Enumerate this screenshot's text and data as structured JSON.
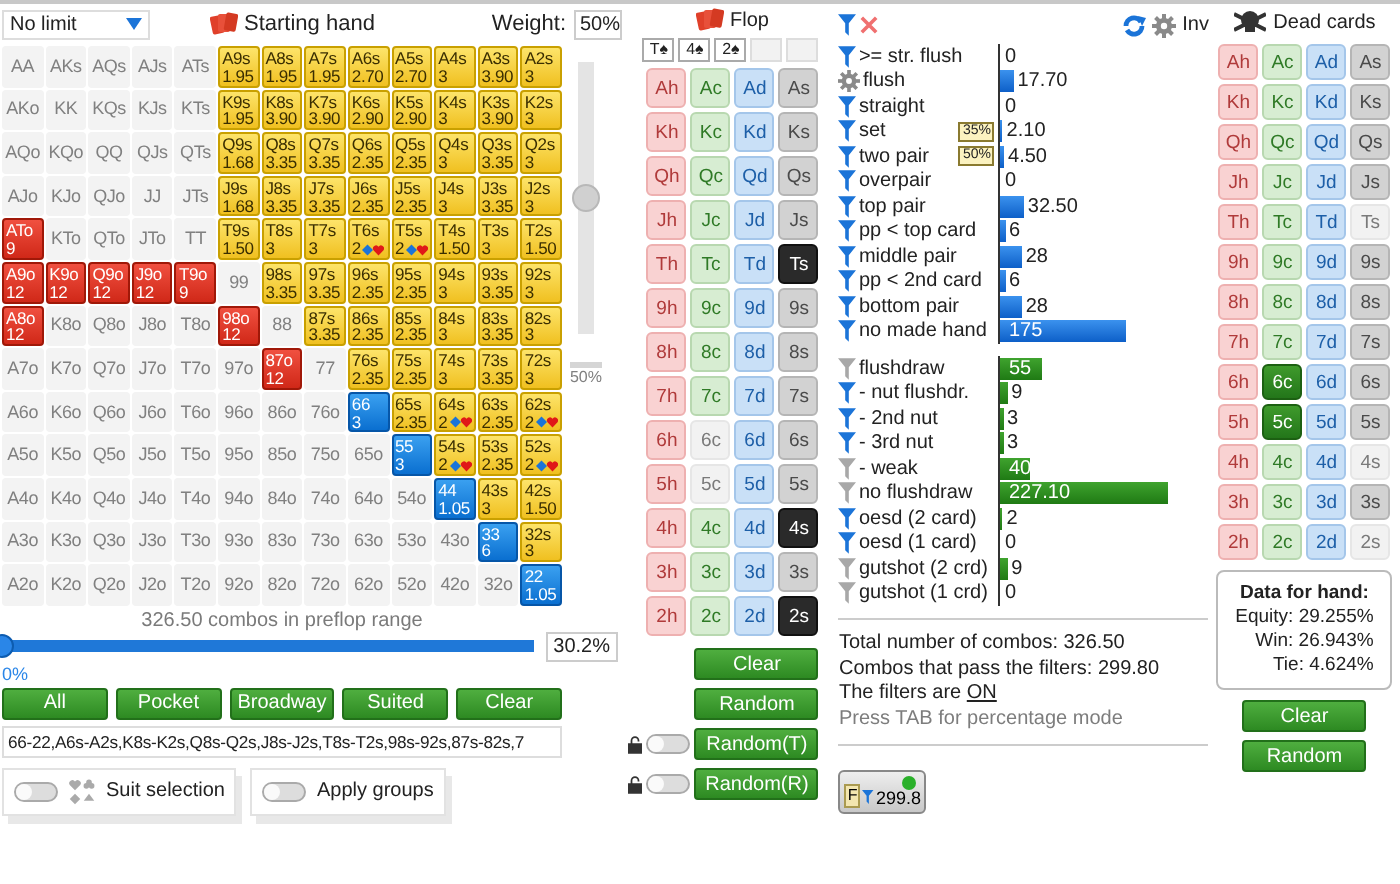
{
  "game": {
    "mode": "No limit"
  },
  "starting_hand": {
    "title": "Starting hand",
    "weight_label": "Weight:",
    "weight": "50%",
    "weight_slider": {
      "level": 0.5
    },
    "weight_slider_label": "50%"
  },
  "range": {
    "grid": [
      [
        {
          "hand": "AA",
          "kind": "off"
        },
        {
          "hand": "AKs",
          "kind": "off"
        },
        {
          "hand": "AQs",
          "kind": "off"
        },
        {
          "hand": "AJs",
          "kind": "off"
        },
        {
          "hand": "ATs",
          "kind": "off"
        },
        {
          "hand": "A9s",
          "kind": "suited",
          "combos": "1.95",
          "partial": false
        },
        {
          "hand": "A8s",
          "kind": "suited",
          "combos": "1.95",
          "partial": false
        },
        {
          "hand": "A7s",
          "kind": "suited",
          "combos": "1.95",
          "partial": false
        },
        {
          "hand": "A6s",
          "kind": "suited",
          "combos": "2.70",
          "partial": false
        },
        {
          "hand": "A5s",
          "kind": "suited",
          "combos": "2.70",
          "partial": false
        },
        {
          "hand": "A4s",
          "kind": "suited",
          "combos": "3",
          "partial": false
        },
        {
          "hand": "A3s",
          "kind": "suited",
          "combos": "3.90",
          "partial": false
        },
        {
          "hand": "A2s",
          "kind": "suited",
          "combos": "3",
          "partial": false
        }
      ],
      [
        {
          "hand": "AKo",
          "kind": "off"
        },
        {
          "hand": "KK",
          "kind": "off"
        },
        {
          "hand": "KQs",
          "kind": "off"
        },
        {
          "hand": "KJs",
          "kind": "off"
        },
        {
          "hand": "KTs",
          "kind": "off"
        },
        {
          "hand": "K9s",
          "kind": "suited",
          "combos": "1.95",
          "partial": false
        },
        {
          "hand": "K8s",
          "kind": "suited",
          "combos": "3.90",
          "partial": false
        },
        {
          "hand": "K7s",
          "kind": "suited",
          "combos": "3.90",
          "partial": false
        },
        {
          "hand": "K6s",
          "kind": "suited",
          "combos": "2.90",
          "partial": false
        },
        {
          "hand": "K5s",
          "kind": "suited",
          "combos": "2.90",
          "partial": false
        },
        {
          "hand": "K4s",
          "kind": "suited",
          "combos": "3",
          "partial": false
        },
        {
          "hand": "K3s",
          "kind": "suited",
          "combos": "3.90",
          "partial": false
        },
        {
          "hand": "K2s",
          "kind": "suited",
          "combos": "3",
          "partial": false
        }
      ],
      [
        {
          "hand": "AQo",
          "kind": "off"
        },
        {
          "hand": "KQo",
          "kind": "off"
        },
        {
          "hand": "QQ",
          "kind": "off"
        },
        {
          "hand": "QJs",
          "kind": "off"
        },
        {
          "hand": "QTs",
          "kind": "off"
        },
        {
          "hand": "Q9s",
          "kind": "suited",
          "combos": "1.68",
          "partial": false
        },
        {
          "hand": "Q8s",
          "kind": "suited",
          "combos": "3.35",
          "partial": false
        },
        {
          "hand": "Q7s",
          "kind": "suited",
          "combos": "3.35",
          "partial": false
        },
        {
          "hand": "Q6s",
          "kind": "suited",
          "combos": "2.35",
          "partial": false
        },
        {
          "hand": "Q5s",
          "kind": "suited",
          "combos": "2.35",
          "partial": false
        },
        {
          "hand": "Q4s",
          "kind": "suited",
          "combos": "3",
          "partial": false
        },
        {
          "hand": "Q3s",
          "kind": "suited",
          "combos": "3.35",
          "partial": false
        },
        {
          "hand": "Q2s",
          "kind": "suited",
          "combos": "3",
          "partial": false
        }
      ],
      [
        {
          "hand": "AJo",
          "kind": "off"
        },
        {
          "hand": "KJo",
          "kind": "off"
        },
        {
          "hand": "QJo",
          "kind": "off"
        },
        {
          "hand": "JJ",
          "kind": "off"
        },
        {
          "hand": "JTs",
          "kind": "off"
        },
        {
          "hand": "J9s",
          "kind": "suited",
          "combos": "1.68",
          "partial": false
        },
        {
          "hand": "J8s",
          "kind": "suited",
          "combos": "3.35",
          "partial": false
        },
        {
          "hand": "J7s",
          "kind": "suited",
          "combos": "3.35",
          "partial": false
        },
        {
          "hand": "J6s",
          "kind": "suited",
          "combos": "2.35",
          "partial": false
        },
        {
          "hand": "J5s",
          "kind": "suited",
          "combos": "2.35",
          "partial": false
        },
        {
          "hand": "J4s",
          "kind": "suited",
          "combos": "3",
          "partial": false
        },
        {
          "hand": "J3s",
          "kind": "suited",
          "combos": "3.35",
          "partial": false
        },
        {
          "hand": "J2s",
          "kind": "suited",
          "combos": "3",
          "partial": false
        }
      ],
      [
        {
          "hand": "ATo",
          "kind": "offsuit",
          "combos": "9",
          "partial": false
        },
        {
          "hand": "KTo",
          "kind": "off"
        },
        {
          "hand": "QTo",
          "kind": "off"
        },
        {
          "hand": "JTo",
          "kind": "off"
        },
        {
          "hand": "TT",
          "kind": "off"
        },
        {
          "hand": "T9s",
          "kind": "suited",
          "combos": "1.50",
          "partial": false
        },
        {
          "hand": "T8s",
          "kind": "suited",
          "combos": "3",
          "partial": false
        },
        {
          "hand": "T7s",
          "kind": "suited",
          "combos": "3",
          "partial": false
        },
        {
          "hand": "T6s",
          "kind": "suited",
          "combos": "2",
          "partial": true
        },
        {
          "hand": "T5s",
          "kind": "suited",
          "combos": "2",
          "partial": true
        },
        {
          "hand": "T4s",
          "kind": "suited",
          "combos": "1.50",
          "partial": false
        },
        {
          "hand": "T3s",
          "kind": "suited",
          "combos": "3",
          "partial": false
        },
        {
          "hand": "T2s",
          "kind": "suited",
          "combos": "1.50",
          "partial": false
        }
      ],
      [
        {
          "hand": "A9o",
          "kind": "offsuit",
          "combos": "12",
          "partial": false
        },
        {
          "hand": "K9o",
          "kind": "offsuit",
          "combos": "12",
          "partial": false
        },
        {
          "hand": "Q9o",
          "kind": "offsuit",
          "combos": "12",
          "partial": false
        },
        {
          "hand": "J9o",
          "kind": "offsuit",
          "combos": "12",
          "partial": false
        },
        {
          "hand": "T9o",
          "kind": "offsuit",
          "combos": "9",
          "partial": false
        },
        {
          "hand": "99",
          "kind": "off"
        },
        {
          "hand": "98s",
          "kind": "suited",
          "combos": "3.35",
          "partial": false
        },
        {
          "hand": "97s",
          "kind": "suited",
          "combos": "3.35",
          "partial": false
        },
        {
          "hand": "96s",
          "kind": "suited",
          "combos": "2.35",
          "partial": false
        },
        {
          "hand": "95s",
          "kind": "suited",
          "combos": "2.35",
          "partial": false
        },
        {
          "hand": "94s",
          "kind": "suited",
          "combos": "3",
          "partial": false
        },
        {
          "hand": "93s",
          "kind": "suited",
          "combos": "3.35",
          "partial": false
        },
        {
          "hand": "92s",
          "kind": "suited",
          "combos": "3",
          "partial": false
        }
      ],
      [
        {
          "hand": "A8o",
          "kind": "offsuit",
          "combos": "12",
          "partial": false
        },
        {
          "hand": "K8o",
          "kind": "off"
        },
        {
          "hand": "Q8o",
          "kind": "off"
        },
        {
          "hand": "J8o",
          "kind": "off"
        },
        {
          "hand": "T8o",
          "kind": "off"
        },
        {
          "hand": "98o",
          "kind": "offsuit",
          "combos": "12",
          "partial": false
        },
        {
          "hand": "88",
          "kind": "off"
        },
        {
          "hand": "87s",
          "kind": "suited",
          "combos": "3.35",
          "partial": false
        },
        {
          "hand": "86s",
          "kind": "suited",
          "combos": "2.35",
          "partial": false
        },
        {
          "hand": "85s",
          "kind": "suited",
          "combos": "2.35",
          "partial": false
        },
        {
          "hand": "84s",
          "kind": "suited",
          "combos": "3",
          "partial": false
        },
        {
          "hand": "83s",
          "kind": "suited",
          "combos": "3.35",
          "partial": false
        },
        {
          "hand": "82s",
          "kind": "suited",
          "combos": "3",
          "partial": false
        }
      ],
      [
        {
          "hand": "A7o",
          "kind": "off"
        },
        {
          "hand": "K7o",
          "kind": "off"
        },
        {
          "hand": "Q7o",
          "kind": "off"
        },
        {
          "hand": "J7o",
          "kind": "off"
        },
        {
          "hand": "T7o",
          "kind": "off"
        },
        {
          "hand": "97o",
          "kind": "off"
        },
        {
          "hand": "87o",
          "kind": "offsuit",
          "combos": "12",
          "partial": false
        },
        {
          "hand": "77",
          "kind": "off"
        },
        {
          "hand": "76s",
          "kind": "suited",
          "combos": "2.35",
          "partial": false
        },
        {
          "hand": "75s",
          "kind": "suited",
          "combos": "2.35",
          "partial": false
        },
        {
          "hand": "74s",
          "kind": "suited",
          "combos": "3",
          "partial": false
        },
        {
          "hand": "73s",
          "kind": "suited",
          "combos": "3.35",
          "partial": false
        },
        {
          "hand": "72s",
          "kind": "suited",
          "combos": "3",
          "partial": false
        }
      ],
      [
        {
          "hand": "A6o",
          "kind": "off"
        },
        {
          "hand": "K6o",
          "kind": "off"
        },
        {
          "hand": "Q6o",
          "kind": "off"
        },
        {
          "hand": "J6o",
          "kind": "off"
        },
        {
          "hand": "T6o",
          "kind": "off"
        },
        {
          "hand": "96o",
          "kind": "off"
        },
        {
          "hand": "86o",
          "kind": "off"
        },
        {
          "hand": "76o",
          "kind": "off"
        },
        {
          "hand": "66",
          "kind": "pair",
          "combos": "3",
          "partial": false
        },
        {
          "hand": "65s",
          "kind": "suited",
          "combos": "2.35",
          "partial": false
        },
        {
          "hand": "64s",
          "kind": "suited",
          "combos": "2",
          "partial": true
        },
        {
          "hand": "63s",
          "kind": "suited",
          "combos": "2.35",
          "partial": false
        },
        {
          "hand": "62s",
          "kind": "suited",
          "combos": "2",
          "partial": true
        }
      ],
      [
        {
          "hand": "A5o",
          "kind": "off"
        },
        {
          "hand": "K5o",
          "kind": "off"
        },
        {
          "hand": "Q5o",
          "kind": "off"
        },
        {
          "hand": "J5o",
          "kind": "off"
        },
        {
          "hand": "T5o",
          "kind": "off"
        },
        {
          "hand": "95o",
          "kind": "off"
        },
        {
          "hand": "85o",
          "kind": "off"
        },
        {
          "hand": "75o",
          "kind": "off"
        },
        {
          "hand": "65o",
          "kind": "off"
        },
        {
          "hand": "55",
          "kind": "pair",
          "combos": "3",
          "partial": false
        },
        {
          "hand": "54s",
          "kind": "suited",
          "combos": "2",
          "partial": true
        },
        {
          "hand": "53s",
          "kind": "suited",
          "combos": "2.35",
          "partial": false
        },
        {
          "hand": "52s",
          "kind": "suited",
          "combos": "2",
          "partial": true
        }
      ],
      [
        {
          "hand": "A4o",
          "kind": "off"
        },
        {
          "hand": "K4o",
          "kind": "off"
        },
        {
          "hand": "Q4o",
          "kind": "off"
        },
        {
          "hand": "J4o",
          "kind": "off"
        },
        {
          "hand": "T4o",
          "kind": "off"
        },
        {
          "hand": "94o",
          "kind": "off"
        },
        {
          "hand": "84o",
          "kind": "off"
        },
        {
          "hand": "74o",
          "kind": "off"
        },
        {
          "hand": "64o",
          "kind": "off"
        },
        {
          "hand": "54o",
          "kind": "off"
        },
        {
          "hand": "44",
          "kind": "pair",
          "combos": "1.05",
          "partial": false
        },
        {
          "hand": "43s",
          "kind": "suited",
          "combos": "3",
          "partial": false
        },
        {
          "hand": "42s",
          "kind": "suited",
          "combos": "1.50",
          "partial": false
        }
      ],
      [
        {
          "hand": "A3o",
          "kind": "off"
        },
        {
          "hand": "K3o",
          "kind": "off"
        },
        {
          "hand": "Q3o",
          "kind": "off"
        },
        {
          "hand": "J3o",
          "kind": "off"
        },
        {
          "hand": "T3o",
          "kind": "off"
        },
        {
          "hand": "93o",
          "kind": "off"
        },
        {
          "hand": "83o",
          "kind": "off"
        },
        {
          "hand": "73o",
          "kind": "off"
        },
        {
          "hand": "63o",
          "kind": "off"
        },
        {
          "hand": "53o",
          "kind": "off"
        },
        {
          "hand": "43o",
          "kind": "off"
        },
        {
          "hand": "33",
          "kind": "pair",
          "combos": "6",
          "partial": false
        },
        {
          "hand": "32s",
          "kind": "suited",
          "combos": "3",
          "partial": false
        }
      ],
      [
        {
          "hand": "A2o",
          "kind": "off"
        },
        {
          "hand": "K2o",
          "kind": "off"
        },
        {
          "hand": "Q2o",
          "kind": "off"
        },
        {
          "hand": "J2o",
          "kind": "off"
        },
        {
          "hand": "T2o",
          "kind": "off"
        },
        {
          "hand": "92o",
          "kind": "off"
        },
        {
          "hand": "82o",
          "kind": "off"
        },
        {
          "hand": "72o",
          "kind": "off"
        },
        {
          "hand": "62o",
          "kind": "off"
        },
        {
          "hand": "52o",
          "kind": "off"
        },
        {
          "hand": "42o",
          "kind": "off"
        },
        {
          "hand": "32o",
          "kind": "off"
        },
        {
          "hand": "22",
          "kind": "pair",
          "combos": "1.05",
          "partial": false
        }
      ]
    ],
    "combos_text": "326.50 combos in preflop range",
    "slider": {
      "level": 0,
      "min_label": "0%",
      "value": "30.2%"
    },
    "buttons": [
      "All",
      "Pocket",
      "Broadway",
      "Suited",
      "Clear"
    ],
    "text": "66-22,A6s-A2s,K8s-K2s,Q8s-Q2s,J8s-J2s,T8s-T2s,98s-92s,87s-82s,7",
    "toggles": [
      {
        "label": "Suit selection",
        "kind": "suits",
        "on": false
      },
      {
        "label": "Apply groups",
        "kind": "plain",
        "on": false
      }
    ]
  },
  "flop": {
    "title": "Flop",
    "board": [
      "T♠",
      "4♠",
      "2♠"
    ],
    "cards": [
      [
        {
          "label": "Ah",
          "selected": false,
          "disabled": false
        },
        {
          "label": "Ac",
          "selected": false,
          "disabled": false
        },
        {
          "label": "Ad",
          "selected": false,
          "disabled": false
        },
        {
          "label": "As",
          "selected": false,
          "disabled": false
        }
      ],
      [
        {
          "label": "Kh",
          "selected": false,
          "disabled": false
        },
        {
          "label": "Kc",
          "selected": false,
          "disabled": false
        },
        {
          "label": "Kd",
          "selected": false,
          "disabled": false
        },
        {
          "label": "Ks",
          "selected": false,
          "disabled": false
        }
      ],
      [
        {
          "label": "Qh",
          "selected": false,
          "disabled": false
        },
        {
          "label": "Qc",
          "selected": false,
          "disabled": false
        },
        {
          "label": "Qd",
          "selected": false,
          "disabled": false
        },
        {
          "label": "Qs",
          "selected": false,
          "disabled": false
        }
      ],
      [
        {
          "label": "Jh",
          "selected": false,
          "disabled": false
        },
        {
          "label": "Jc",
          "selected": false,
          "disabled": false
        },
        {
          "label": "Jd",
          "selected": false,
          "disabled": false
        },
        {
          "label": "Js",
          "selected": false,
          "disabled": false
        }
      ],
      [
        {
          "label": "Th",
          "selected": false,
          "disabled": false
        },
        {
          "label": "Tc",
          "selected": false,
          "disabled": false
        },
        {
          "label": "Td",
          "selected": false,
          "disabled": false
        },
        {
          "label": "Ts",
          "selected": true,
          "disabled": false
        }
      ],
      [
        {
          "label": "9h",
          "selected": false,
          "disabled": false
        },
        {
          "label": "9c",
          "selected": false,
          "disabled": false
        },
        {
          "label": "9d",
          "selected": false,
          "disabled": false
        },
        {
          "label": "9s",
          "selected": false,
          "disabled": false
        }
      ],
      [
        {
          "label": "8h",
          "selected": false,
          "disabled": false
        },
        {
          "label": "8c",
          "selected": false,
          "disabled": false
        },
        {
          "label": "8d",
          "selected": false,
          "disabled": false
        },
        {
          "label": "8s",
          "selected": false,
          "disabled": false
        }
      ],
      [
        {
          "label": "7h",
          "selected": false,
          "disabled": false
        },
        {
          "label": "7c",
          "selected": false,
          "disabled": false
        },
        {
          "label": "7d",
          "selected": false,
          "disabled": false
        },
        {
          "label": "7s",
          "selected": false,
          "disabled": false
        }
      ],
      [
        {
          "label": "6h",
          "selected": false,
          "disabled": false
        },
        {
          "label": "6c",
          "selected": false,
          "disabled": true
        },
        {
          "label": "6d",
          "selected": false,
          "disabled": false
        },
        {
          "label": "6s",
          "selected": false,
          "disabled": false
        }
      ],
      [
        {
          "label": "5h",
          "selected": false,
          "disabled": false
        },
        {
          "label": "5c",
          "selected": false,
          "disabled": true
        },
        {
          "label": "5d",
          "selected": false,
          "disabled": false
        },
        {
          "label": "5s",
          "selected": false,
          "disabled": false
        }
      ],
      [
        {
          "label": "4h",
          "selected": false,
          "disabled": false
        },
        {
          "label": "4c",
          "selected": false,
          "disabled": false
        },
        {
          "label": "4d",
          "selected": false,
          "disabled": false
        },
        {
          "label": "4s",
          "selected": true,
          "disabled": false
        }
      ],
      [
        {
          "label": "3h",
          "selected": false,
          "disabled": false
        },
        {
          "label": "3c",
          "selected": false,
          "disabled": false
        },
        {
          "label": "3d",
          "selected": false,
          "disabled": false
        },
        {
          "label": "3s",
          "selected": false,
          "disabled": false
        }
      ],
      [
        {
          "label": "2h",
          "selected": false,
          "disabled": false
        },
        {
          "label": "2c",
          "selected": false,
          "disabled": false
        },
        {
          "label": "2d",
          "selected": false,
          "disabled": false
        },
        {
          "label": "2s",
          "selected": true,
          "disabled": false
        }
      ]
    ],
    "buttons": [
      {
        "label": "Clear",
        "kind": "plain"
      },
      {
        "label": "Random",
        "kind": "plain"
      },
      {
        "label": "Random(T)",
        "kind": "locked",
        "on": false
      },
      {
        "label": "Random(R)",
        "kind": "locked",
        "on": false
      }
    ]
  },
  "filters": {
    "inv": "Inv",
    "made": [
      {
        "label": ">= str. flush",
        "kind": "filter",
        "on": true,
        "value": "0",
        "level": 0
      },
      {
        "label": "flush",
        "kind": "gear",
        "value": "17.70",
        "level": 0.06
      },
      {
        "label": "straight",
        "kind": "filter",
        "on": true,
        "value": "0",
        "level": 0
      },
      {
        "label": "set",
        "kind": "filter",
        "on": true,
        "badge": "35%",
        "value": "2.10",
        "level": 0.008
      },
      {
        "label": "two pair",
        "kind": "filter",
        "on": true,
        "badge": "50%",
        "value": "4.50",
        "level": 0.015
      },
      {
        "label": "overpair",
        "kind": "filter",
        "on": true,
        "value": "0",
        "level": 0
      },
      {
        "label": "top pair",
        "kind": "filter",
        "on": true,
        "value": "32.50",
        "level": 0.11
      },
      {
        "label": "pp < top card",
        "kind": "filter",
        "on": true,
        "value": "6",
        "level": 0.02
      },
      {
        "label": "middle pair",
        "kind": "filter",
        "on": true,
        "value": "28",
        "level": 0.1
      },
      {
        "label": "pp < 2nd card",
        "kind": "filter",
        "on": true,
        "value": "6",
        "level": 0.02
      },
      {
        "label": "bottom pair",
        "kind": "filter",
        "on": true,
        "value": "28",
        "level": 0.1
      },
      {
        "label": "no made hand",
        "kind": "filter",
        "on": true,
        "value": "175",
        "level": 0.6
      }
    ],
    "draws": [
      {
        "label": "flushdraw",
        "kind": "filter",
        "on": false,
        "value": "55",
        "level": 0.2
      },
      {
        "label": "- nut flushdr.",
        "kind": "filter",
        "on": true,
        "value": "9",
        "level": 0.03
      },
      {
        "label": "- 2nd nut",
        "kind": "filter",
        "on": true,
        "value": "3",
        "level": 0.01
      },
      {
        "label": "- 3rd nut",
        "kind": "filter",
        "on": true,
        "value": "3",
        "level": 0.01
      },
      {
        "label": "- weak",
        "kind": "filter",
        "on": false,
        "value": "40",
        "level": 0.14
      },
      {
        "label": "no flushdraw",
        "kind": "filter",
        "on": false,
        "value": "227.10",
        "level": 0.8
      },
      {
        "label": "oesd (2 card)",
        "kind": "filter",
        "on": true,
        "value": "2",
        "level": 0.007
      },
      {
        "label": "oesd (1 card)",
        "kind": "filter",
        "on": true,
        "value": "0",
        "level": 0
      },
      {
        "label": "gutshot (2 crd)",
        "kind": "filter",
        "on": false,
        "value": "9",
        "level": 0.03
      },
      {
        "label": "gutshot (1 crd)",
        "kind": "filter",
        "on": false,
        "value": "0",
        "level": 0
      }
    ],
    "summary": {
      "total": "Total number of combos: 326.50",
      "pass": "Combos that pass the filters: 299.80",
      "status": "The filters are",
      "status_link": "ON",
      "hint": "Press TAB for percentage mode"
    },
    "count_button": {
      "letter": "F",
      "value": "299.8",
      "active": true
    }
  },
  "dead": {
    "title": "Dead cards",
    "cards": [
      [
        {
          "label": "Ah",
          "selected": false,
          "disabled": false
        },
        {
          "label": "Ac",
          "selected": false,
          "disabled": false
        },
        {
          "label": "Ad",
          "selected": false,
          "disabled": false
        },
        {
          "label": "As",
          "selected": false,
          "disabled": false
        }
      ],
      [
        {
          "label": "Kh",
          "selected": false,
          "disabled": false
        },
        {
          "label": "Kc",
          "selected": false,
          "disabled": false
        },
        {
          "label": "Kd",
          "selected": false,
          "disabled": false
        },
        {
          "label": "Ks",
          "selected": false,
          "disabled": false
        }
      ],
      [
        {
          "label": "Qh",
          "selected": false,
          "disabled": false
        },
        {
          "label": "Qc",
          "selected": false,
          "disabled": false
        },
        {
          "label": "Qd",
          "selected": false,
          "disabled": false
        },
        {
          "label": "Qs",
          "selected": false,
          "disabled": false
        }
      ],
      [
        {
          "label": "Jh",
          "selected": false,
          "disabled": false
        },
        {
          "label": "Jc",
          "selected": false,
          "disabled": false
        },
        {
          "label": "Jd",
          "selected": false,
          "disabled": false
        },
        {
          "label": "Js",
          "selected": false,
          "disabled": false
        }
      ],
      [
        {
          "label": "Th",
          "selected": false,
          "disabled": false
        },
        {
          "label": "Tc",
          "selected": false,
          "disabled": false
        },
        {
          "label": "Td",
          "selected": false,
          "disabled": false
        },
        {
          "label": "Ts",
          "selected": false,
          "disabled": true
        }
      ],
      [
        {
          "label": "9h",
          "selected": false,
          "disabled": false
        },
        {
          "label": "9c",
          "selected": false,
          "disabled": false
        },
        {
          "label": "9d",
          "selected": false,
          "disabled": false
        },
        {
          "label": "9s",
          "selected": false,
          "disabled": false
        }
      ],
      [
        {
          "label": "8h",
          "selected": false,
          "disabled": false
        },
        {
          "label": "8c",
          "selected": false,
          "disabled": false
        },
        {
          "label": "8d",
          "selected": false,
          "disabled": false
        },
        {
          "label": "8s",
          "selected": false,
          "disabled": false
        }
      ],
      [
        {
          "label": "7h",
          "selected": false,
          "disabled": false
        },
        {
          "label": "7c",
          "selected": false,
          "disabled": false
        },
        {
          "label": "7d",
          "selected": false,
          "disabled": false
        },
        {
          "label": "7s",
          "selected": false,
          "disabled": false
        }
      ],
      [
        {
          "label": "6h",
          "selected": false,
          "disabled": false
        },
        {
          "label": "6c",
          "selected": true,
          "disabled": false
        },
        {
          "label": "6d",
          "selected": false,
          "disabled": false
        },
        {
          "label": "6s",
          "selected": false,
          "disabled": false
        }
      ],
      [
        {
          "label": "5h",
          "selected": false,
          "disabled": false
        },
        {
          "label": "5c",
          "selected": true,
          "disabled": false
        },
        {
          "label": "5d",
          "selected": false,
          "disabled": false
        },
        {
          "label": "5s",
          "selected": false,
          "disabled": false
        }
      ],
      [
        {
          "label": "4h",
          "selected": false,
          "disabled": false
        },
        {
          "label": "4c",
          "selected": false,
          "disabled": false
        },
        {
          "label": "4d",
          "selected": false,
          "disabled": false
        },
        {
          "label": "4s",
          "selected": false,
          "disabled": true
        }
      ],
      [
        {
          "label": "3h",
          "selected": false,
          "disabled": false
        },
        {
          "label": "3c",
          "selected": false,
          "disabled": false
        },
        {
          "label": "3d",
          "selected": false,
          "disabled": false
        },
        {
          "label": "3s",
          "selected": false,
          "disabled": false
        }
      ],
      [
        {
          "label": "2h",
          "selected": false,
          "disabled": false
        },
        {
          "label": "2c",
          "selected": false,
          "disabled": false
        },
        {
          "label": "2d",
          "selected": false,
          "disabled": false
        },
        {
          "label": "2s",
          "selected": false,
          "disabled": true
        }
      ]
    ],
    "data": {
      "title": "Data for hand:",
      "lines": [
        "Equity: 29.255%",
        "Win: 26.943%",
        "Tie: 4.624%"
      ]
    },
    "buttons": [
      "Clear",
      "Random"
    ]
  }
}
